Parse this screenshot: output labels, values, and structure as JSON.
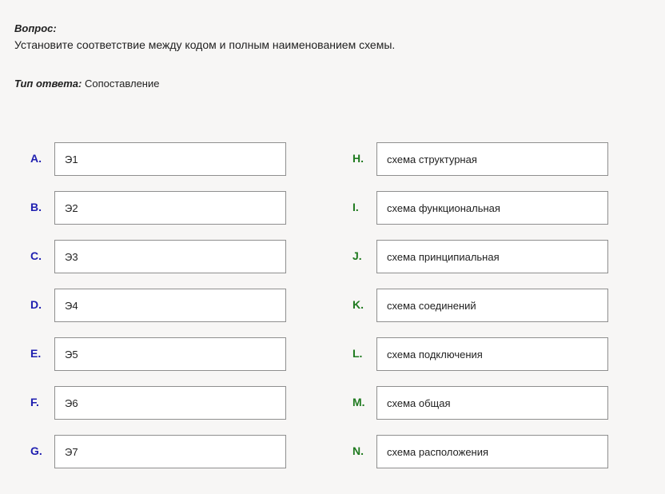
{
  "question": {
    "label": "Вопрос:",
    "text": "Установите соответствие между кодом и полным наименованием схемы."
  },
  "answer_type": {
    "label": "Тип ответа:",
    "value": "Сопоставление"
  },
  "left_items": [
    {
      "letter": "A.",
      "text": "Э1"
    },
    {
      "letter": "B.",
      "text": "Э2"
    },
    {
      "letter": "C.",
      "text": "Э3"
    },
    {
      "letter": "D.",
      "text": "Э4"
    },
    {
      "letter": "E.",
      "text": "Э5"
    },
    {
      "letter": "F.",
      "text": "Э6"
    },
    {
      "letter": "G.",
      "text": "Э7"
    }
  ],
  "right_items": [
    {
      "letter": "H.",
      "text": "схема структурная"
    },
    {
      "letter": "I.",
      "text": "схема функциональная"
    },
    {
      "letter": "J.",
      "text": "схема принципиальная"
    },
    {
      "letter": "K.",
      "text": "схема соединений"
    },
    {
      "letter": "L.",
      "text": "схема подключения"
    },
    {
      "letter": "M.",
      "text": "схема общая"
    },
    {
      "letter": "N.",
      "text": "схема расположения"
    }
  ]
}
